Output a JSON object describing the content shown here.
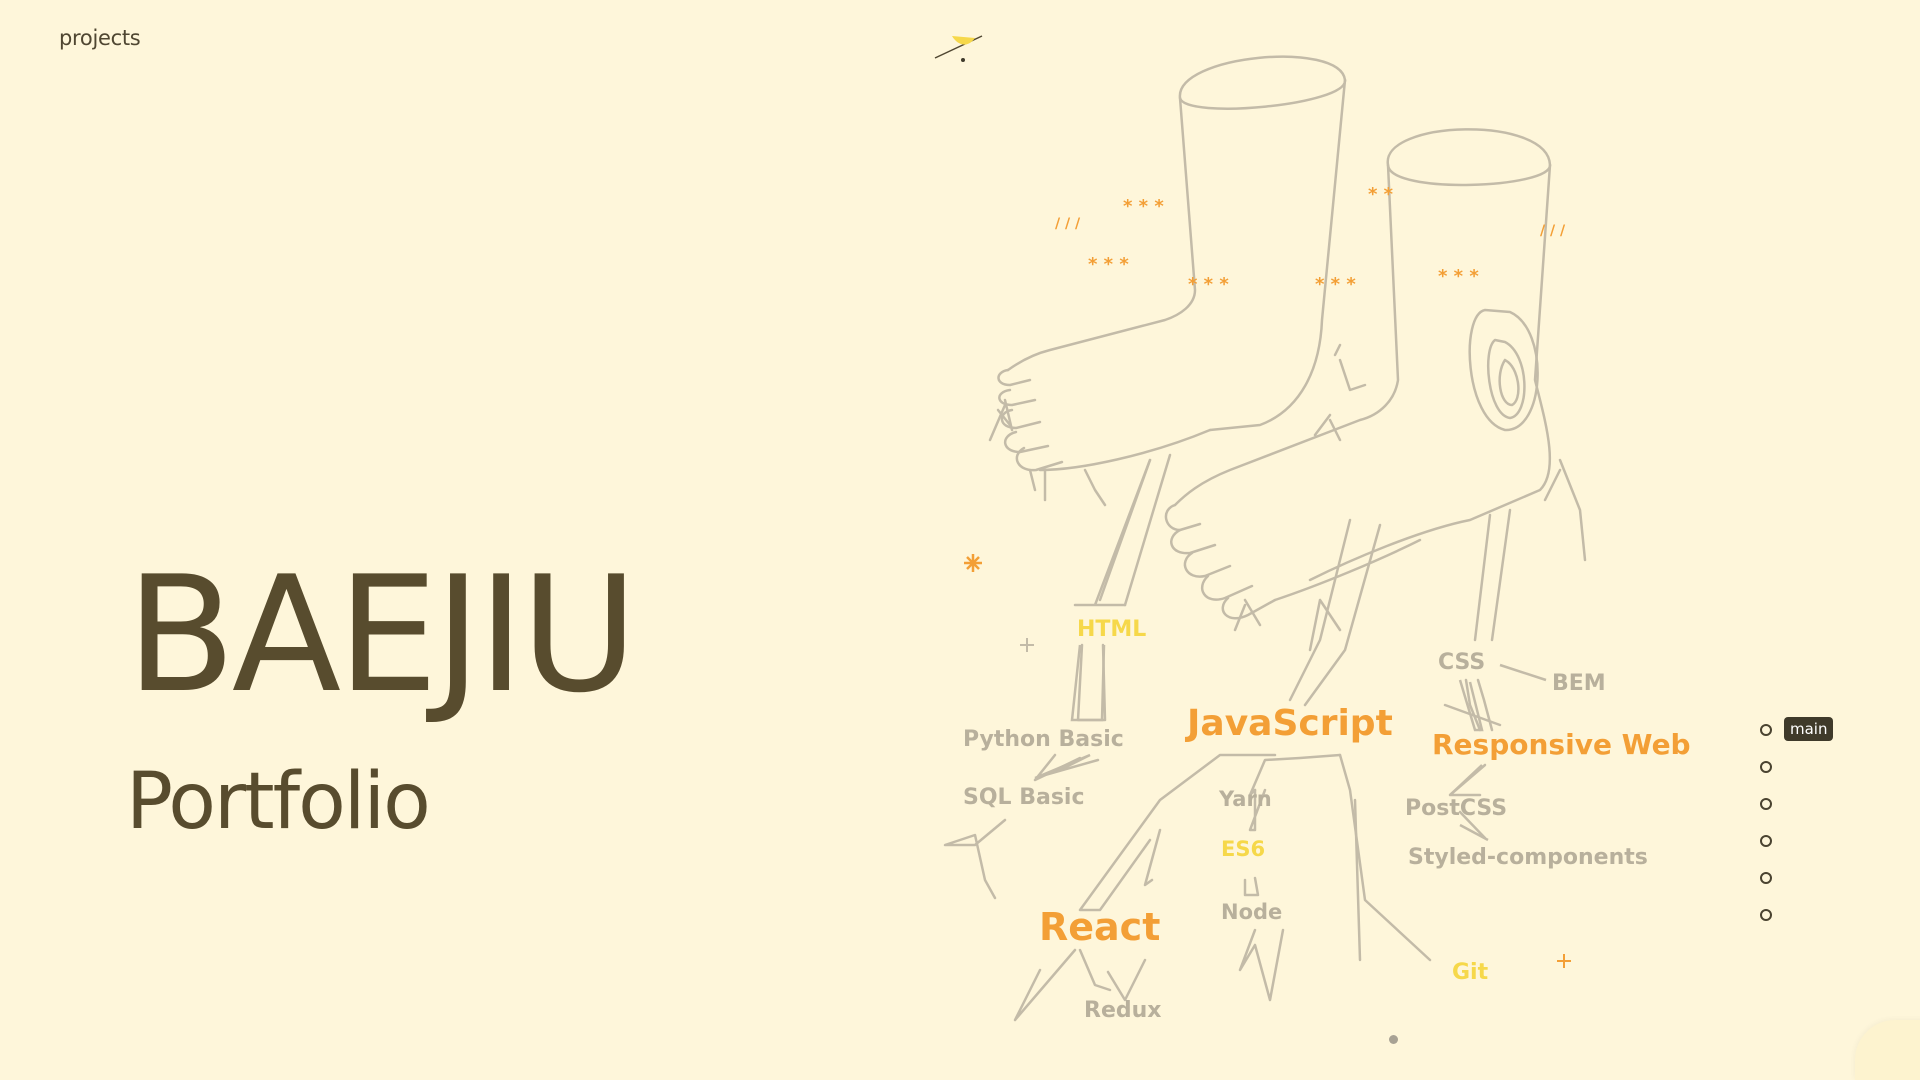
{
  "header": {
    "nav_link": "projects"
  },
  "hero": {
    "title": "BAEJIU",
    "subtitle": "Portfolio"
  },
  "skills": {
    "html": "HTML",
    "python": "Python Basic",
    "sql": "SQL Basic",
    "javascript": "JavaScript",
    "yarn": "Yarn",
    "es6": "ES6",
    "node": "Node",
    "react": "React",
    "redux": "Redux",
    "css": "CSS",
    "bem": "BEM",
    "responsive": "Responsive Web",
    "postcss": "PostCSS",
    "styled": "Styled-components",
    "git": "Git"
  },
  "section_nav": {
    "items": [
      {
        "label": "main",
        "active": true
      },
      {
        "label": "",
        "active": false
      },
      {
        "label": "",
        "active": false
      },
      {
        "label": "",
        "active": false
      },
      {
        "label": "",
        "active": false
      },
      {
        "label": "",
        "active": false
      }
    ]
  },
  "colors": {
    "background": "#fef6da",
    "text_dark": "#584c2e",
    "orange": "#f39f36",
    "yellow": "#f6d84a",
    "gray": "#b8b09c",
    "line": "#c3bba8"
  }
}
